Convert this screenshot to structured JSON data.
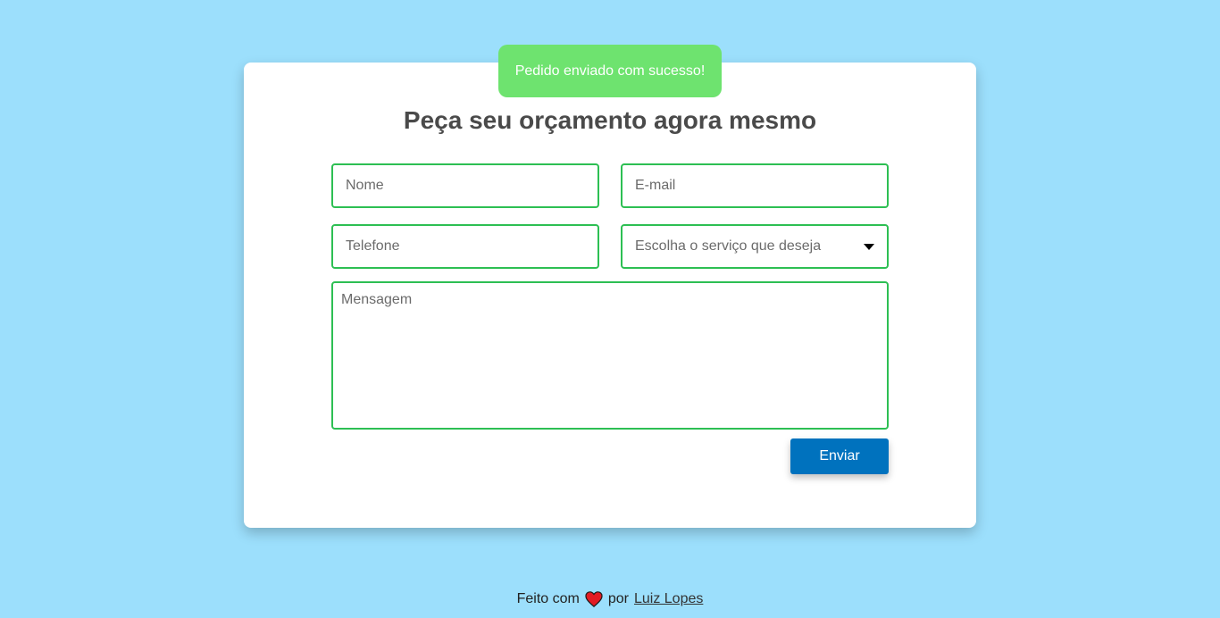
{
  "toast": {
    "message": "Pedido enviado com sucesso!"
  },
  "form": {
    "title": "Peça seu orçamento agora mesmo",
    "name_placeholder": "Nome",
    "email_placeholder": "E-mail",
    "phone_placeholder": "Telefone",
    "service_placeholder": "Escolha o serviço que deseja",
    "message_placeholder": "Mensagem",
    "submit_label": "Enviar"
  },
  "footer": {
    "prefix": "Feito com",
    "middle": "por",
    "author": "Luiz Lopes",
    "heart_icon": "heart-icon"
  },
  "colors": {
    "background": "#9cdffc",
    "toast": "#6ee36f",
    "field_border": "#2dbf53",
    "button": "#0072be",
    "heart": "#e21b23"
  }
}
